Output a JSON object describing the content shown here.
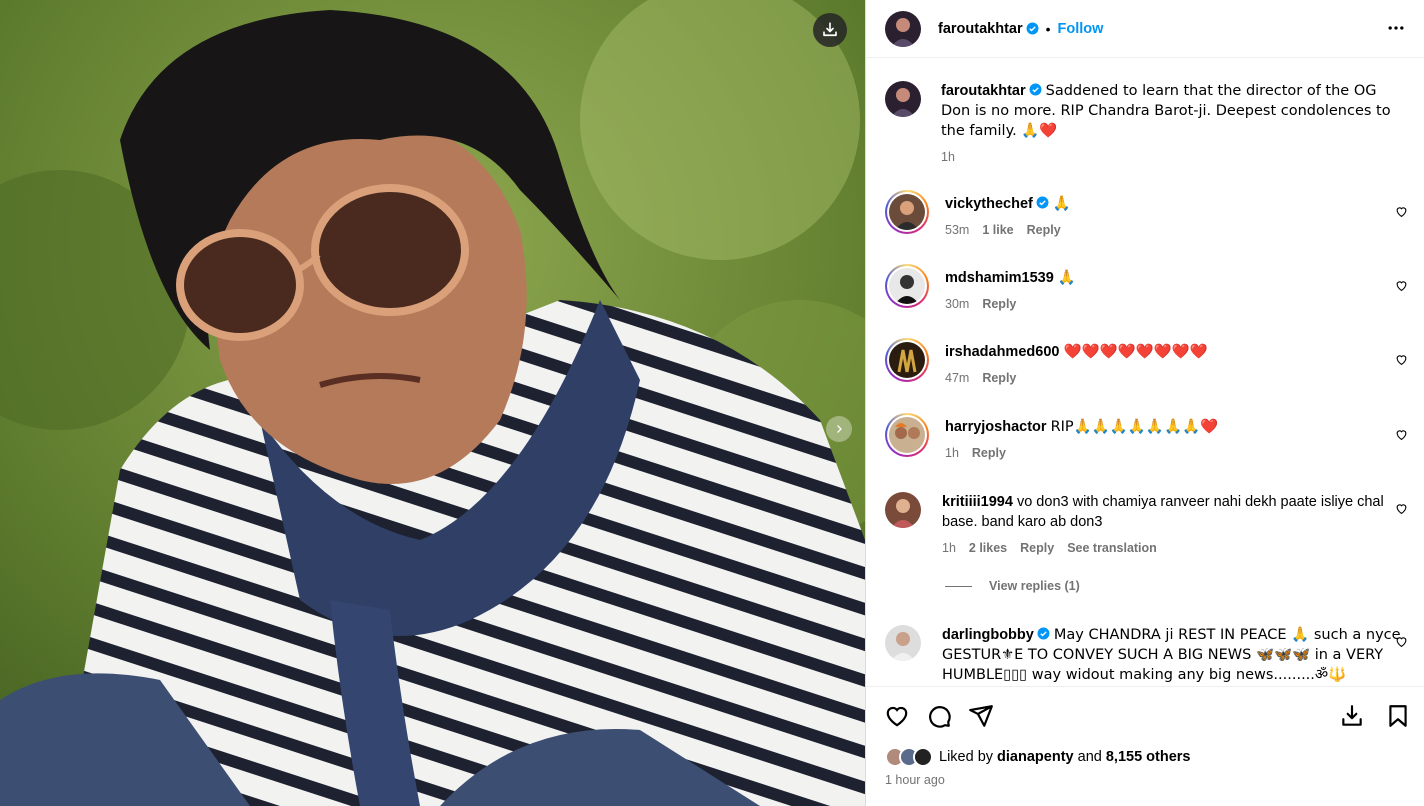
{
  "post": {
    "username": "faroutakhtar",
    "follow_label": "Follow",
    "dot": "•",
    "caption": "Saddened to learn that the director of the OG Don is no more. RIP Chandra Barot-ji. Deepest condolences to the family. 🙏❤️",
    "caption_time": "1h"
  },
  "comments": [
    {
      "username": "vickythechef",
      "text": "🙏",
      "time": "53m",
      "likes": "1 like",
      "reply": "Reply",
      "verified": true
    },
    {
      "username": "mdshamim1539",
      "text": "🙏",
      "time": "30m",
      "likes": "",
      "reply": "Reply",
      "verified": false
    },
    {
      "username": "irshadahmed600",
      "text": "❤️❤️❤️❤️❤️❤️❤️❤️",
      "time": "47m",
      "likes": "",
      "reply": "Reply",
      "verified": false
    },
    {
      "username": "harryjoshactor",
      "text": "RIP🙏🙏🙏🙏🙏🙏🙏❤️",
      "time": "1h",
      "likes": "",
      "reply": "Reply",
      "verified": false
    },
    {
      "username": "kritiiii1994",
      "text": "vo don3 with chamiya ranveer nahi dekh paate isliye chal base. band karo ab don3",
      "time": "1h",
      "likes": "2 likes",
      "reply": "Reply",
      "translation": "See translation",
      "verified": false
    },
    {
      "username": "darlingbobby",
      "text": "May CHANDRA ji REST IN PEACE 🙏 such a nyce GESTUR⚜E TO CONVEY SUCH A BIG NEWS 🦋🦋🦋 in a VERY HUMBLE▯▯▯ way widout making any big news.........ॐ🔱",
      "verified": true
    }
  ],
  "view_replies": "View replies (1)",
  "footer": {
    "liked_prefix": "Liked by ",
    "liked_user": "dianapenty",
    "liked_mid": " and ",
    "liked_count": "8,155 others",
    "time_ago": "1 hour ago"
  },
  "icons": [
    "download-icon",
    "next-icon",
    "verified-icon",
    "more-icon",
    "heart-icon",
    "comment-icon",
    "share-icon",
    "save-to-collection-icon",
    "bookmark-icon"
  ],
  "colors": {
    "follow": "#0095f6",
    "meta": "#737373",
    "verified": "#0095f6"
  }
}
